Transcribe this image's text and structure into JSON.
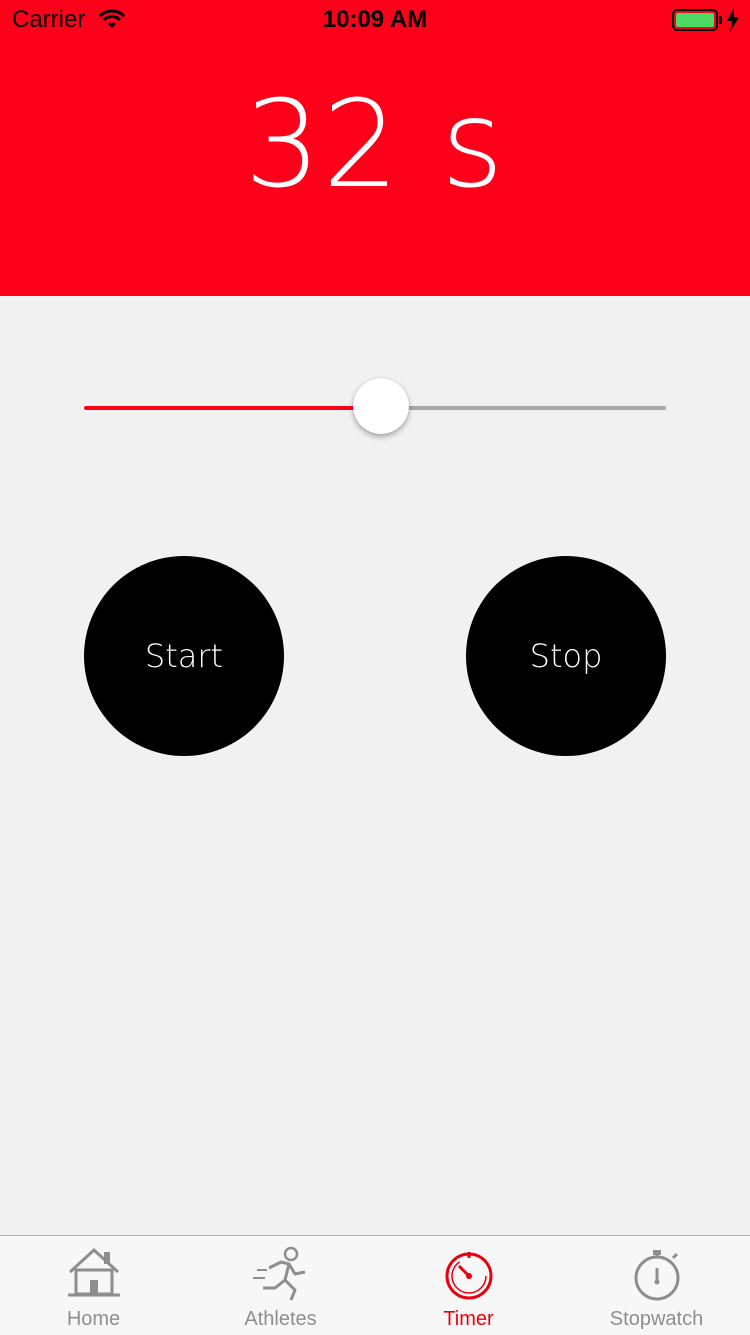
{
  "status_bar": {
    "carrier": "Carrier",
    "time": "10:09 AM",
    "battery_color": "#4cd964"
  },
  "timer": {
    "display": "32 s",
    "slider_fraction": 0.51
  },
  "controls": {
    "start_label": "Start",
    "stop_label": "Stop"
  },
  "tab_bar": {
    "tabs": [
      {
        "label": "Home",
        "icon": "house-icon",
        "active": false
      },
      {
        "label": "Athletes",
        "icon": "runner-icon",
        "active": false
      },
      {
        "label": "Timer",
        "icon": "timer-icon",
        "active": true
      },
      {
        "label": "Stopwatch",
        "icon": "stopwatch-icon",
        "active": false
      }
    ]
  },
  "colors": {
    "accent": "#fe0019",
    "background": "#f1f1f1",
    "button": "#000000",
    "inactive_tab": "#8e8e8e"
  }
}
